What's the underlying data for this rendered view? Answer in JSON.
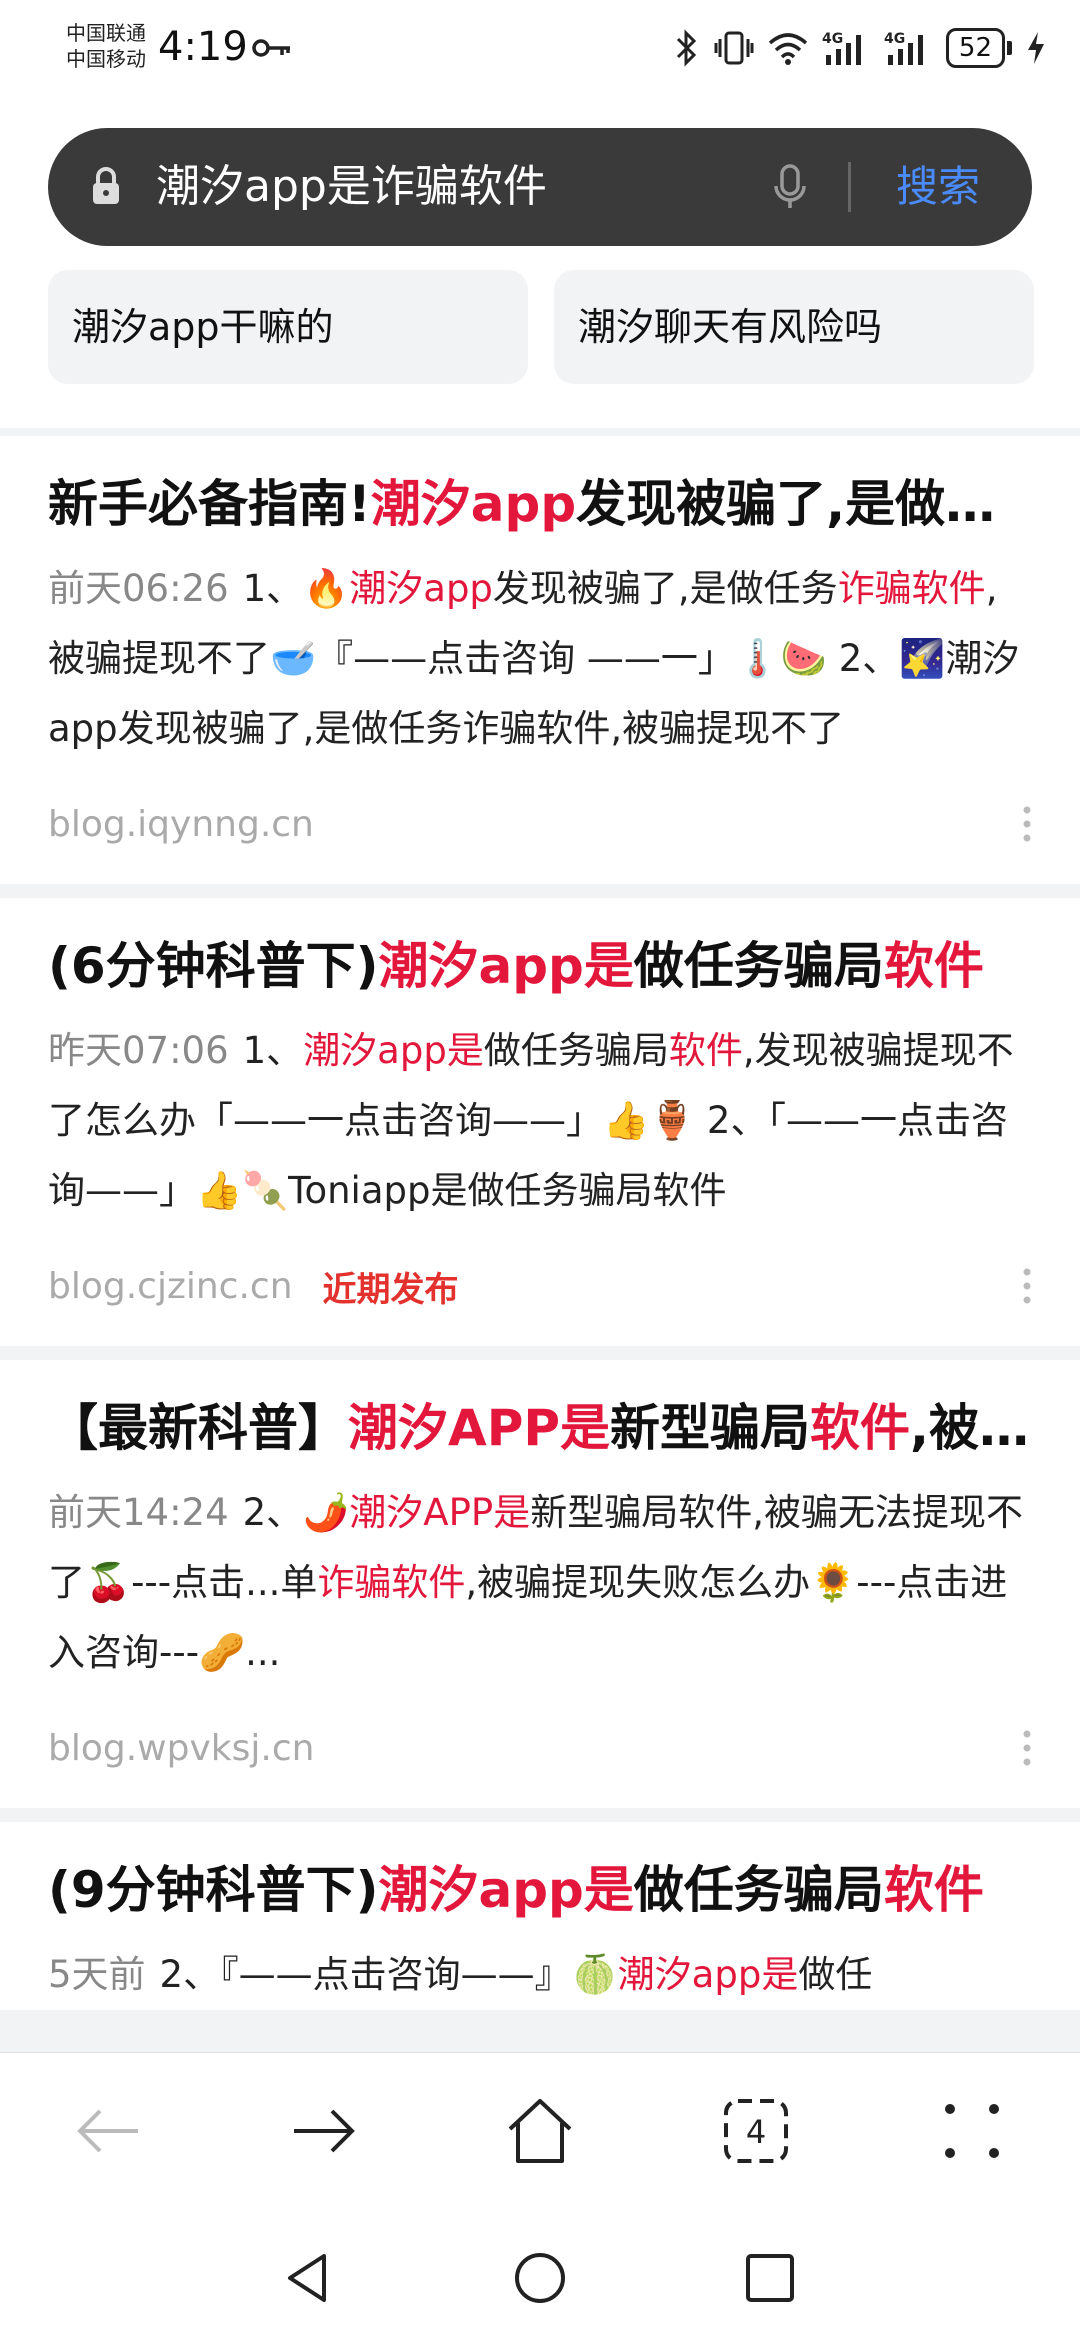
{
  "status": {
    "carrier1": "中国联通",
    "carrier2": "中国移动",
    "time": "4:19",
    "battery": "52",
    "network1": "4G",
    "network2": "4G"
  },
  "search": {
    "query": "潮汐app是诈骗软件",
    "button": "搜索"
  },
  "suggestions": [
    {
      "label": "潮汐app干嘛的"
    },
    {
      "label": "潮汐聊天有风险吗"
    }
  ],
  "results": [
    {
      "title_a": "新手必备指南!",
      "title_b": "潮汐app",
      "title_c": "发现被骗了,是做任务诈骗软件",
      "date": "前天06:26",
      "body_a": "1、🔥",
      "body_b": "潮汐app",
      "body_c": "发现被骗了,是做任务",
      "body_d": "诈骗软件",
      "body_e": ",被骗提现不了🥣『——点击咨询 ——一」🌡️🍉 2、🌠潮汐app发现被骗了,是做任务诈骗软件,被骗提现不了",
      "source": "blog.iqynng.cn",
      "tag": ""
    },
    {
      "title_a": "(6分钟科普下)",
      "title_b": "潮汐app是",
      "title_c": "做任务骗局",
      "title_d": "软件",
      "date": "昨天07:06",
      "body_a": "1、",
      "body_b": "潮汐app是",
      "body_c": "做任务骗局",
      "body_d": "软件",
      "body_e": ",发现被骗提现不了怎么办「——一点击咨询——」👍🏺 2、「——一点击咨询——」👍🍡Toniapp是做任务骗局软件",
      "source": "blog.cjzinc.cn",
      "tag": "近期发布"
    },
    {
      "title_a": "【最新科普】",
      "title_b": "潮汐APP是",
      "title_c": "新型骗局",
      "title_d": "软件",
      "title_e": ",被骗无法提现",
      "date": "前天14:24",
      "body_a": "2、🌶️",
      "body_b": "潮汐APP是",
      "body_c": "新型骗局软件,被骗无法提现不了🍒---点击...单",
      "body_d": "诈骗软件",
      "body_e": ",被骗提现失败怎么办🌻---点击进入咨询---🥜...",
      "source": "blog.wpvksj.cn",
      "tag": ""
    },
    {
      "title_a": "(9分钟科普下)",
      "title_b": "潮汐app是",
      "title_c": "做任务骗局",
      "title_d": "软件",
      "date": "5天前",
      "body_a": "2、『——点击咨询——』🍈",
      "body_b": "潮汐app是",
      "body_c": "做任",
      "source": "",
      "tag": ""
    }
  ],
  "nav": {
    "tab_count": "4"
  }
}
